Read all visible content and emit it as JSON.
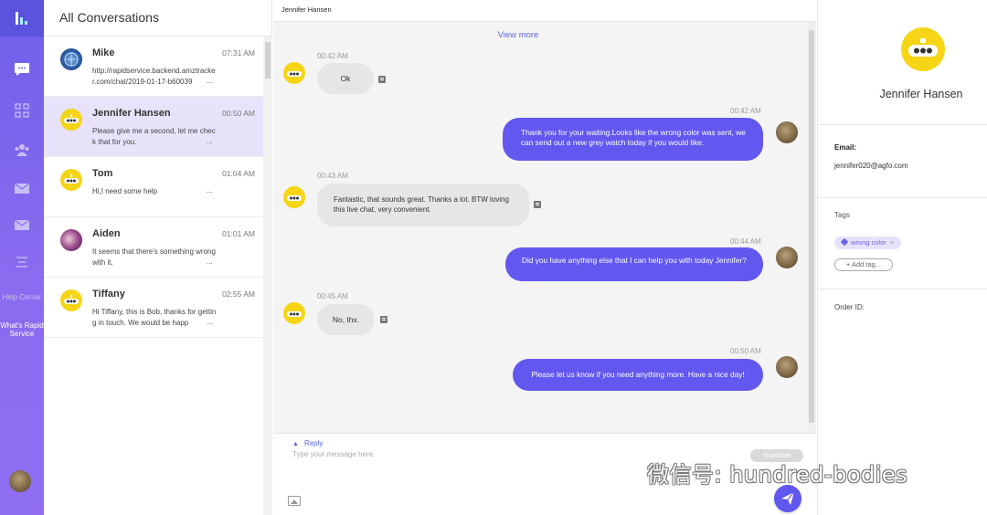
{
  "nav": {
    "help_center": "Help Center",
    "whats_new": "What's Rapid Service",
    "icons": [
      "chat-icon",
      "qr-code-icon",
      "users-icon",
      "mail-icon",
      "mail-outline-icon",
      "list-icon"
    ]
  },
  "conversations": {
    "title": "All Conversations",
    "items": [
      {
        "name": "Mike",
        "time": "07:31 AM",
        "preview": "http://rapidservice.backend.amztracker.com/chat/2019-01-17-b60039",
        "dots": "...",
        "avatar": "blue-globe"
      },
      {
        "name": "Jennifer Hansen",
        "time": "00:50 AM",
        "preview": "Please give me a second, let me check that for you.",
        "dots": "...",
        "avatar": "yellow-robot"
      },
      {
        "name": "Tom",
        "time": "01:04 AM",
        "preview": "Hi,I need some help",
        "dots": "...",
        "avatar": "yellow-robot"
      },
      {
        "name": "Aiden",
        "time": "01:01 AM",
        "preview": "It seems that there's something wrong with it.",
        "dots": "...",
        "avatar": "purple-photo"
      },
      {
        "name": "Tiffany",
        "time": "02:55 AM",
        "preview": "Hi Tiffany, this is Bob, thanks for getting in touch. We would be happ",
        "dots": "...",
        "avatar": "yellow-robot"
      }
    ]
  },
  "chat": {
    "header": "Jennifer Hansen",
    "view_more": "View more",
    "messages": [
      {
        "dir": "in",
        "time": "00:42 AM",
        "text": "Ok"
      },
      {
        "dir": "out",
        "time": "00:42 AM",
        "text": "Thank you for your waiting.Looks like the wrong color was sent, we can send out a new grey watch today if you would like."
      },
      {
        "dir": "in",
        "time": "00:43 AM",
        "text": "Fantastic, that sounds great. Thanks a lot. BTW loving this live chat, very convenient."
      },
      {
        "dir": "out",
        "time": "00:44 AM",
        "text": "Did you have anything else that I can help you with today Jennifer?"
      },
      {
        "dir": "in",
        "time": "00:45 AM",
        "text": "No, thx."
      },
      {
        "dir": "out",
        "time": "00:50 AM",
        "text": "Please let us know if you need anything more. Have a nice day!"
      }
    ],
    "reply_label": "Reply",
    "reply_placeholder": "Type your message here.",
    "translate_label": "Translate"
  },
  "profile": {
    "name": "Jennifer Hansen",
    "email_label": "Email:",
    "email": "jennifer020@agfo.com",
    "tags_label": "Tags",
    "tag": "wrong color",
    "tag_remove": "×",
    "add_tag": "Add tag...",
    "order_label": "Order ID:"
  },
  "watermark": "微信号: hundred-bodies",
  "colors": {
    "accent": "#6257ef",
    "nav_gradient_top": "#6f5fe8",
    "nav_gradient_bottom": "#8f6ef2",
    "active_row": "#e8e3fb",
    "link": "#5b66d9"
  }
}
